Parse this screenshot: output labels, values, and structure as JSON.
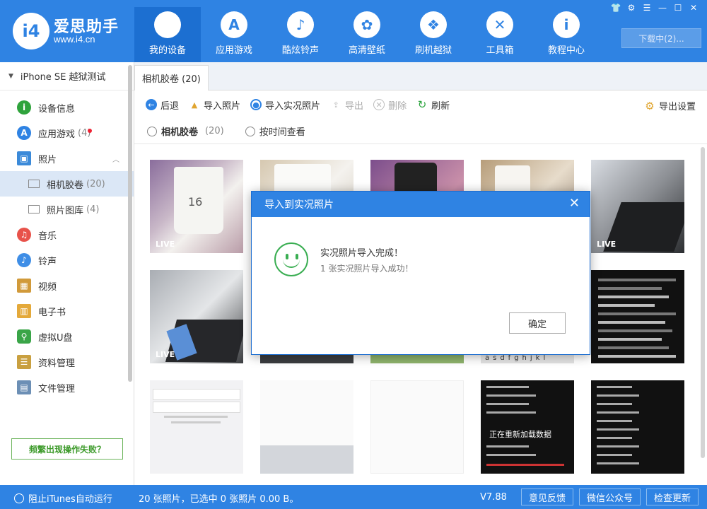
{
  "app": {
    "brand_name": "爱思助手",
    "brand_url": "www.i4.cn",
    "logo_text": "i4",
    "download_label": "下载中(2)..."
  },
  "nav": [
    {
      "label": "我的设备",
      "icon": "apple-icon",
      "glyph": "",
      "active": true
    },
    {
      "label": "应用游戏",
      "icon": "appstore-icon",
      "glyph": "A"
    },
    {
      "label": "酷炫铃声",
      "icon": "bell-icon",
      "glyph": "♪"
    },
    {
      "label": "高清壁纸",
      "icon": "flower-icon",
      "glyph": "✿"
    },
    {
      "label": "刷机越狱",
      "icon": "box-icon",
      "glyph": "❖"
    },
    {
      "label": "工具箱",
      "icon": "tools-icon",
      "glyph": "✕"
    },
    {
      "label": "教程中心",
      "icon": "info-icon",
      "glyph": "i"
    }
  ],
  "sidebar": {
    "device_name": "iPhone SE 越狱测试",
    "items": [
      {
        "label": "设备信息",
        "icon": "info-circle-icon",
        "color": "#2fa33c",
        "glyph": "i"
      },
      {
        "label": "应用游戏",
        "icon": "appstore-icon",
        "color": "#2f83e3",
        "glyph": "A",
        "count": "(4)"
      },
      {
        "label": "照片",
        "icon": "photo-icon",
        "color": "#3b8ad9",
        "glyph": "▣"
      },
      {
        "label": "相机胶卷",
        "count": "(20)"
      },
      {
        "label": "照片图库",
        "count": "(4)"
      },
      {
        "label": "音乐",
        "icon": "music-icon",
        "color": "#e8524a",
        "glyph": "♫"
      },
      {
        "label": "铃声",
        "icon": "bell-icon",
        "color": "#3f8ee6",
        "glyph": "♪"
      },
      {
        "label": "视频",
        "icon": "video-icon",
        "color": "#d19a3a",
        "glyph": "▦"
      },
      {
        "label": "电子书",
        "icon": "book-icon",
        "color": "#e4a93a",
        "glyph": "▥"
      },
      {
        "label": "虚拟U盘",
        "icon": "usb-icon",
        "color": "#3aa548",
        "glyph": "⚲"
      },
      {
        "label": "资料管理",
        "icon": "doc-icon",
        "color": "#c9a040",
        "glyph": "☰"
      },
      {
        "label": "文件管理",
        "icon": "folder-icon",
        "color": "#6c8fb5",
        "glyph": "▤"
      }
    ],
    "freq_button": "频繁出现操作失败？"
  },
  "main": {
    "tab_label": "相机胶卷 (20)",
    "toolbar": {
      "back": "后退",
      "import_photo": "导入照片",
      "import_live": "导入实况照片",
      "export": "导出",
      "delete": "删除",
      "refresh": "刷新",
      "export_settings": "导出设置"
    },
    "filter": {
      "camera_roll": "相机胶卷",
      "camera_roll_count": "(20)",
      "by_time": "按时间查看"
    },
    "live_label": "LIVE",
    "reload_text": "正在重新加载数据"
  },
  "dialog": {
    "title": "导入到实况照片",
    "message": "实况照片导入完成！",
    "sub_message": "1 张实况照片导入成功！",
    "ok": "确定"
  },
  "status": {
    "block_itunes": "阻止iTunes自动运行",
    "summary": "20 张照片，已选中 0 张照片 0.00 B。",
    "version": "V7.88",
    "feedback": "意见反馈",
    "wechat": "微信公众号",
    "check_update": "检查更新"
  }
}
